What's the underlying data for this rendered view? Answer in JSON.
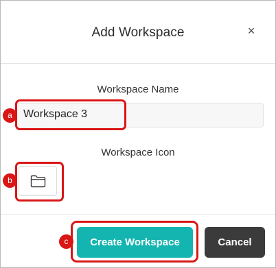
{
  "dialog": {
    "title": "Add Workspace",
    "close_glyph": "×"
  },
  "form": {
    "name_label": "Workspace Name",
    "name_value": "Workspace 3",
    "icon_label": "Workspace Icon",
    "icon": "folder-icon"
  },
  "footer": {
    "create_label": "Create Workspace",
    "cancel_label": "Cancel"
  },
  "annotations": {
    "a": "a",
    "b": "b",
    "c": "c",
    "highlight_color": "#d91515"
  },
  "colors": {
    "primary": "#14b5b0",
    "secondary": "#3b3b3b"
  }
}
